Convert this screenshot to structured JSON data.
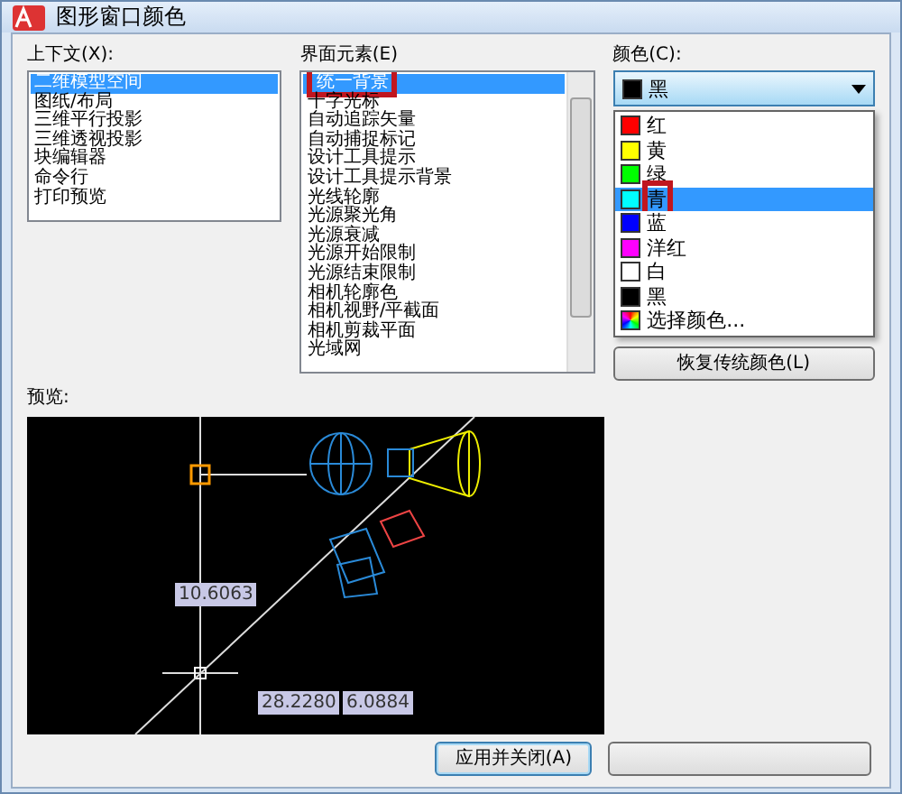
{
  "window": {
    "title": "图形窗口颜色"
  },
  "context": {
    "label": "上下文(X):",
    "items": [
      {
        "label": "二维模型空间",
        "selected": true
      },
      {
        "label": "图纸/布局",
        "selected": false
      },
      {
        "label": "三维平行投影",
        "selected": false
      },
      {
        "label": "三维透视投影",
        "selected": false
      },
      {
        "label": "块编辑器",
        "selected": false
      },
      {
        "label": "命令行",
        "selected": false
      },
      {
        "label": "打印预览",
        "selected": false
      }
    ]
  },
  "elements": {
    "label": "界面元素(E)",
    "highlighted": true,
    "items": [
      {
        "label": "统一背景",
        "selected": true
      },
      {
        "label": "十字光标",
        "selected": false
      },
      {
        "label": "自动追踪矢量",
        "selected": false
      },
      {
        "label": "自动捕捉标记",
        "selected": false
      },
      {
        "label": "设计工具提示",
        "selected": false
      },
      {
        "label": "设计工具提示背景",
        "selected": false
      },
      {
        "label": "光线轮廓",
        "selected": false
      },
      {
        "label": "光源聚光角",
        "selected": false
      },
      {
        "label": "光源衰减",
        "selected": false
      },
      {
        "label": "光源开始限制",
        "selected": false
      },
      {
        "label": "光源结束限制",
        "selected": false
      },
      {
        "label": "相机轮廓色",
        "selected": false
      },
      {
        "label": "相机视野/平截面",
        "selected": false
      },
      {
        "label": "相机剪裁平面",
        "selected": false
      },
      {
        "label": "光域网",
        "selected": false
      }
    ]
  },
  "color": {
    "label": "颜色(C):",
    "value": {
      "label": "黑",
      "color": "#000000"
    },
    "options": [
      {
        "kind": "swatch",
        "label": "红",
        "color": "#ff0000",
        "selected": false,
        "highlighted": false
      },
      {
        "kind": "swatch",
        "label": "黄",
        "color": "#ffff00",
        "selected": false,
        "highlighted": false
      },
      {
        "kind": "swatch",
        "label": "绿",
        "color": "#00ff00",
        "selected": false,
        "highlighted": false
      },
      {
        "kind": "swatch",
        "label": "青",
        "color": "#00ffff",
        "selected": true,
        "highlighted": true
      },
      {
        "kind": "swatch",
        "label": "蓝",
        "color": "#0000ff",
        "selected": false,
        "highlighted": false
      },
      {
        "kind": "swatch",
        "label": "洋红",
        "color": "#ff00ff",
        "selected": false,
        "highlighted": false
      },
      {
        "kind": "swatch",
        "label": "白",
        "color": "#ffffff",
        "selected": false,
        "highlighted": false
      },
      {
        "kind": "swatch",
        "label": "黑",
        "color": "#000000",
        "selected": false,
        "highlighted": false
      },
      {
        "kind": "picker",
        "label": "选择颜色...",
        "selected": false,
        "highlighted": false
      }
    ],
    "restore_button": "恢复传统颜色(L)"
  },
  "preview": {
    "label": "预览:",
    "values": [
      "10.6063",
      "28.2280",
      "6.0884"
    ]
  },
  "buttons": [
    "应用并关闭(A)"
  ]
}
